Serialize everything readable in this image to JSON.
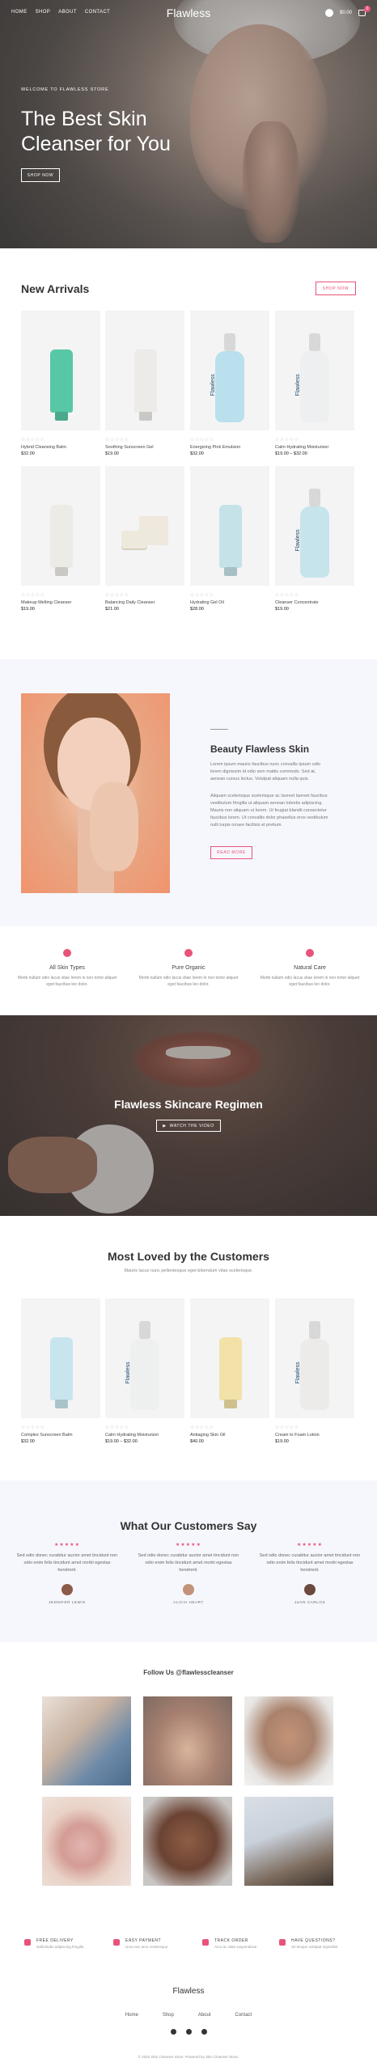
{
  "header": {
    "nav": [
      "HOME",
      "SHOP",
      "ABOUT",
      "CONTACT"
    ],
    "logo": "Flawless",
    "cart_total": "$0.00",
    "cart_count": "0"
  },
  "hero": {
    "kicker": "WELCOME TO FLAWLESS STORE",
    "title": "The Best Skin Cleanser for You",
    "button": "SHOP NOW"
  },
  "new_arrivals": {
    "title": "New Arrivals",
    "button": "SHOP NOW",
    "stars": "☆☆☆☆☆",
    "products": [
      {
        "name": "Hybrid Cleansing Balm",
        "price": "$32.00",
        "kind": "tube",
        "color": "#57c7a6"
      },
      {
        "name": "Soothing Sunscreen Gel",
        "price": "$19.00",
        "kind": "tube",
        "color": "#ecebe8"
      },
      {
        "name": "Energizing Pink Emulsion",
        "price": "$32.00",
        "kind": "pump",
        "color": "#b9e0ec"
      },
      {
        "name": "Calm Hydrating Moisturizer",
        "price": "$19.00 – $32.00",
        "kind": "pump",
        "color": "#eeeff0"
      },
      {
        "name": "Makeup Melting Cleanser",
        "price": "$19.00",
        "kind": "tube",
        "color": "#ecebe6"
      },
      {
        "name": "Balancing Daily Cleanser",
        "price": "$21.00",
        "kind": "jar",
        "color": "#eee9dd"
      },
      {
        "name": "Hydrating Gel Oil",
        "price": "$28.00",
        "kind": "tube",
        "color": "#c5e2e8"
      },
      {
        "name": "Cleanser Concentrate",
        "price": "$19.00",
        "kind": "pump",
        "color": "#c6e4ec"
      }
    ]
  },
  "beauty": {
    "title": "Beauty Flawless Skin",
    "para1": "Lorem ipsum mauris faucibus nunc convallis ipsum odio lorem dignissim id odio sem mattis commodo. Sed at, aenean cursus lectus. Volutpat aliquam nulla quis.",
    "para2": "Aliquam scelerisque scelerisque ac laoreet laoreet faucibus vestibulum fringilla ut aliquam aenean lobortis adipiscing. Mauris non aliquam ut lorem. Ut feugiat blandit consectetur faucibus lorem. Ut convallis dolor phasellus eros vestibulum nulli turpis ornare facilisis et pretium.",
    "button": "READ MORE"
  },
  "features": [
    {
      "title": "All Skin Types",
      "text": "Morbi nullam odio lacus vitae lorem in non tortor aliquet eget faucibus leo dolor."
    },
    {
      "title": "Pure Organic",
      "text": "Morbi nullam odio lacus vitae lorem in non tortor aliquet eget faucibus leo dolor."
    },
    {
      "title": "Natural Care",
      "text": "Morbi nullam odio lacus vitae lorem in non tortor aliquet eget faucibus leo dolor."
    }
  ],
  "regimen": {
    "title": "Flawless Skincare Regimen",
    "button": "WATCH THE VIDEO"
  },
  "most_loved": {
    "title": "Most Loved by the Customers",
    "subtitle": "Mauris lacus nunc pellentesque eget bibendum vitae scelerisque.",
    "products": [
      {
        "name": "Complex Sunscreen Balm",
        "price": "$32.00",
        "kind": "tube",
        "color": "#c8e5ee"
      },
      {
        "name": "Calm Hydrating Moisturizer",
        "price": "$19.00 – $32.00",
        "kind": "pump",
        "color": "#eef0f0"
      },
      {
        "name": "Antiaging Skin Oil",
        "price": "$40.00",
        "kind": "tube",
        "color": "#f2e2a8"
      },
      {
        "name": "Cream to Foam Lotion",
        "price": "$19.00",
        "kind": "pump",
        "color": "#ecebea"
      }
    ]
  },
  "testimonials": {
    "title": "What Our Customers Say",
    "stars": "★★★★★",
    "items": [
      {
        "text": "Sed odio donec curabitur auctor amet tincidunt non odio enim felis tincidunt amet morbi egestas hendrerit.",
        "name": "JENNIFER LEWIS",
        "avatar": "#8c5a48"
      },
      {
        "text": "Sed odio donec curabitur auctor amet tincidunt non odio enim felis tincidunt amet morbi egestas hendrerit.",
        "name": "ALICIA HEART",
        "avatar": "#c2937a"
      },
      {
        "text": "Sed odio donec curabitur auctor amet tincidunt non odio enim felis tincidunt amet morbi egestas hendrerit.",
        "name": "JUAN CARLOS",
        "avatar": "#6b4a3d"
      }
    ]
  },
  "instagram": {
    "title": "Follow Us @flawlesscleanser"
  },
  "services": [
    {
      "title": "FREE DELIVERY",
      "text": "Sollicitudin adipiscing fringilla"
    },
    {
      "title": "EASY PAYMENT",
      "text": "Urna nec arcu scelerisque"
    },
    {
      "title": "TRACK ORDER",
      "text": "Arcu ac vitae suspendisse"
    },
    {
      "title": "HAVE QUESTIONS?",
      "text": "Sit tempor volutpat imperdiet"
    }
  ],
  "footer": {
    "logo": "Flawless",
    "menu": [
      "Home",
      "Shop",
      "About",
      "Contact"
    ],
    "copyright": "© 2022 Skin Cleanser Store. Powered by Skin Cleanser Store."
  },
  "colors": {
    "accent": "#e8537a",
    "soft_bg": "#f6f7fd"
  }
}
